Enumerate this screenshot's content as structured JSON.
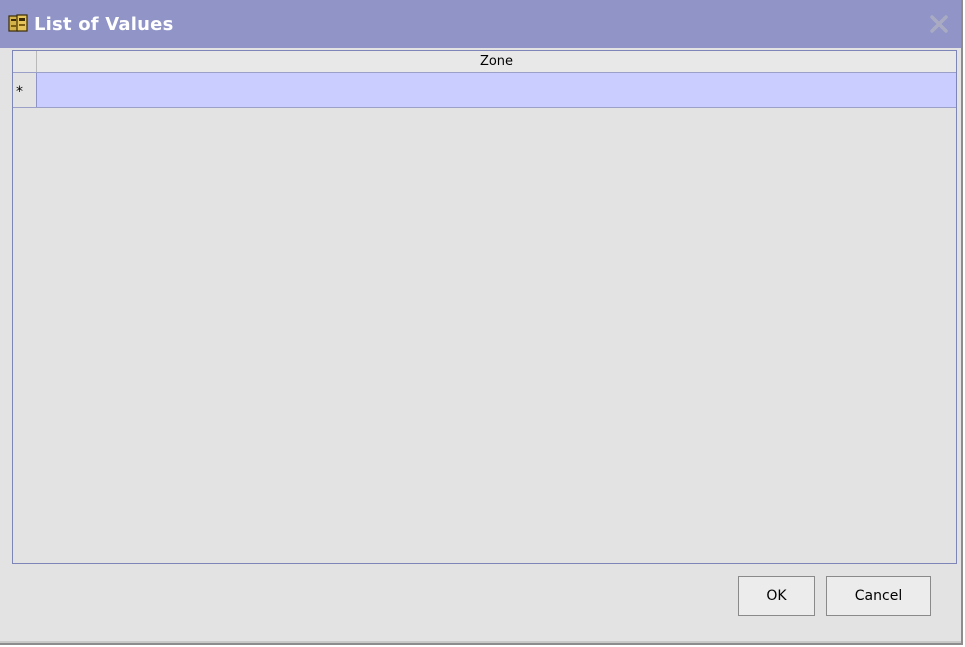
{
  "window": {
    "title": "List of Values",
    "icon": "lov-book-icon",
    "close_icon": "close-icon",
    "title_bar_color": "#9094c7"
  },
  "table": {
    "columns": [
      {
        "header": "Zone"
      }
    ],
    "rows": [
      {
        "marker": "*",
        "zone": ""
      }
    ],
    "selected_row_color": "#c9cdff"
  },
  "buttons": {
    "ok_label": "OK",
    "cancel_label": "Cancel"
  }
}
